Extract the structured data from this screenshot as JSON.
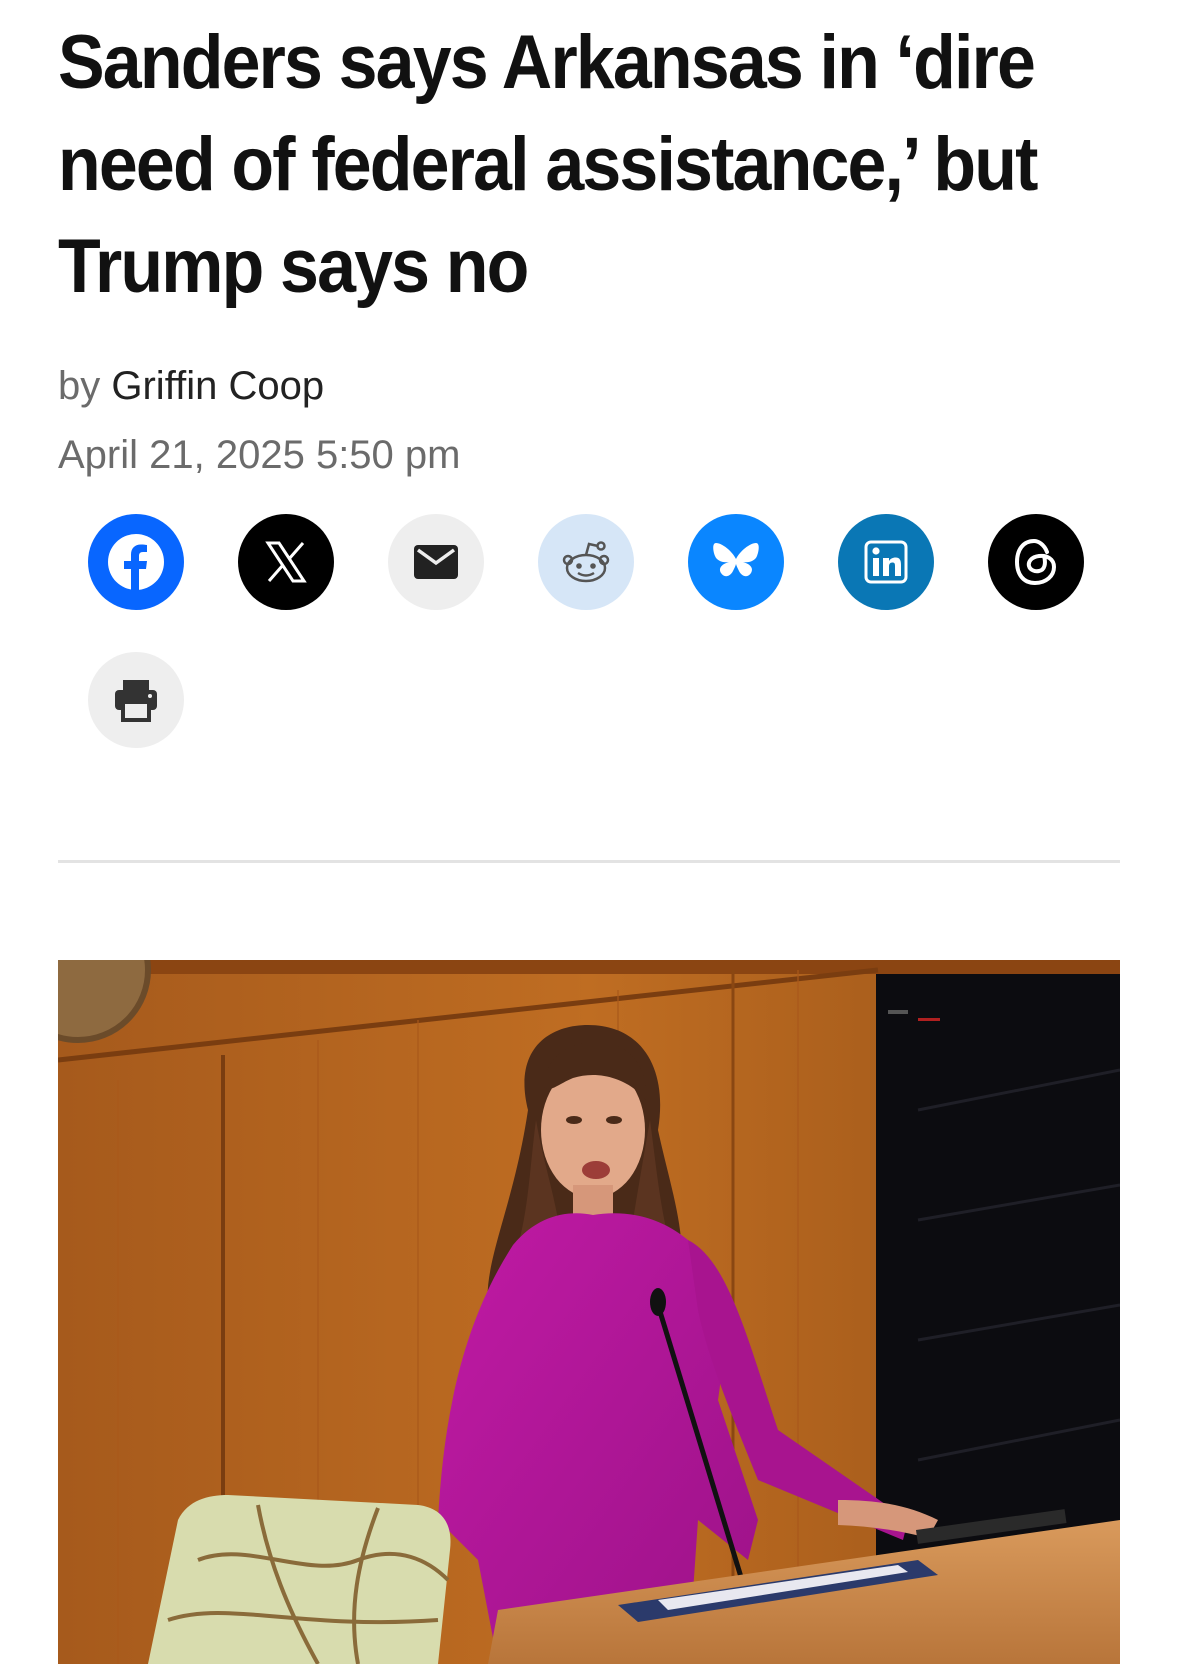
{
  "article": {
    "headline": "Sanders says Arkansas in ‘dire need of federal as­sistance,’ but Trump says no",
    "byline_prefix": "by",
    "author": "Griffin Coop",
    "timestamp": "April 21, 2025 5:50 pm"
  },
  "share_buttons": [
    {
      "icon": "facebook-icon",
      "color": "#0866ff"
    },
    {
      "icon": "x-icon",
      "color": "#000000"
    },
    {
      "icon": "email-icon",
      "color": "#eeeeee"
    },
    {
      "icon": "reddit-icon",
      "color": "#d6e6f7"
    },
    {
      "icon": "bluesky-icon",
      "color": "#0a86ff"
    },
    {
      "icon": "linkedin-icon",
      "color": "#0a77b5"
    },
    {
      "icon": "threads-icon",
      "color": "#000000"
    },
    {
      "icon": "print-icon",
      "color": "#eeeeee"
    }
  ],
  "colors": {
    "headline": "#111111",
    "meta": "#6b6b6b",
    "divider": "#e3e3e3"
  }
}
